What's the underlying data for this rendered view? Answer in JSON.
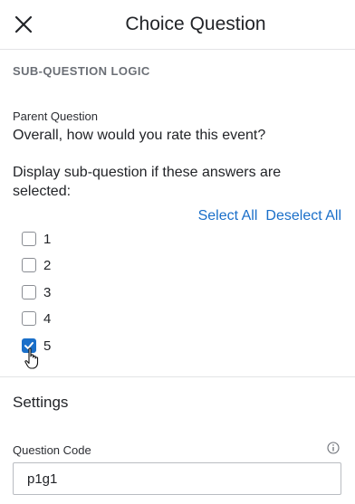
{
  "header": {
    "title": "Choice Question",
    "close_icon": "close-icon"
  },
  "logic": {
    "section_title": "SUB-QUESTION LOGIC",
    "parent_label": "Parent Question",
    "parent_question": "Overall, how would you rate this event?",
    "display_text": "Display sub-question if these answers are selected:",
    "select_all": "Select All",
    "deselect_all": "Deselect All",
    "options": [
      {
        "label": "1",
        "checked": false
      },
      {
        "label": "2",
        "checked": false
      },
      {
        "label": "3",
        "checked": false
      },
      {
        "label": "4",
        "checked": false
      },
      {
        "label": "5",
        "checked": true
      }
    ]
  },
  "settings": {
    "title": "Settings",
    "question_code_label": "Question Code",
    "question_code_value": "p1g1",
    "info_icon": "info-icon"
  },
  "colors": {
    "accent": "#1a6fc9",
    "heading_gray": "#6b6f76"
  }
}
